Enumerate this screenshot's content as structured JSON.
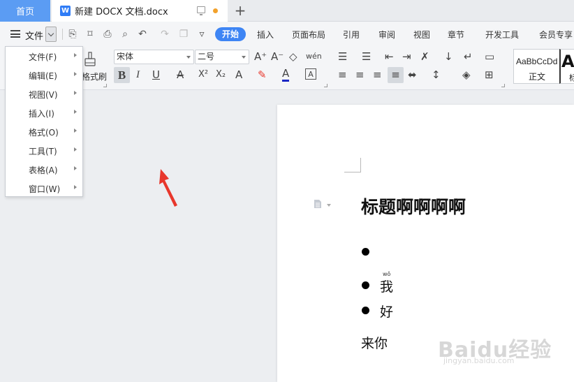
{
  "tabs": {
    "home_label": "首页",
    "doc_label": "新建 DOCX 文档.docx",
    "wps_logo": "W",
    "add_label": "+"
  },
  "menu": {
    "file_label": "文件",
    "ribbon_tabs": [
      "开始",
      "插入",
      "页面布局",
      "引用",
      "审阅",
      "视图",
      "章节",
      "开发工具",
      "会员专享"
    ]
  },
  "quick_access": {
    "icons": [
      "save-icon",
      "format-painter-icon",
      "print-icon",
      "print-preview-icon",
      "undo-icon",
      "redo-icon",
      "copy-icon",
      "more-icon"
    ],
    "glyphs": [
      "⎘",
      "⌑",
      "⎙",
      "⌕",
      "↶",
      "↷",
      "❐",
      "▿"
    ]
  },
  "toolbar": {
    "format_painter_label": "格式刷",
    "font_name": "宋体",
    "font_size": "二号",
    "style_sample": "AaBbCcDd",
    "style_label": "正文",
    "style_next_sample": "A",
    "style_next_label": "标",
    "row1_glyphs": [
      "A⁺",
      "A⁻",
      "◇",
      "wén",
      "☰",
      "☰",
      "⇤",
      "⇥",
      "✗",
      "↓",
      "↵",
      "▭"
    ],
    "row2_glyphs": [
      "I",
      "U",
      "A",
      "X²",
      "X₂",
      "A",
      "✎",
      "A",
      "A",
      "≡",
      "≡",
      "≡",
      "≡",
      "⬌",
      "↕",
      "◈",
      "⊞"
    ]
  },
  "file_dropdown": {
    "items": [
      "文件(F)",
      "编辑(E)",
      "视图(V)",
      "插入(I)",
      "格式(O)",
      "工具(T)",
      "表格(A)",
      "窗口(W)"
    ]
  },
  "document": {
    "heading": "标题啊啊啊啊",
    "bullets": [
      "",
      "我",
      "好"
    ],
    "pinyin": "wǒ",
    "plain_text": "来你"
  },
  "watermark": {
    "brand": "Baidu经验",
    "url": "jingyan.baidu.com"
  },
  "colors": {
    "accent_blue": "#3e85f4",
    "home_tab_blue": "#5b9cf3",
    "arrow_red": "#e8372c",
    "unsaved_dot": "#f2a12b"
  }
}
